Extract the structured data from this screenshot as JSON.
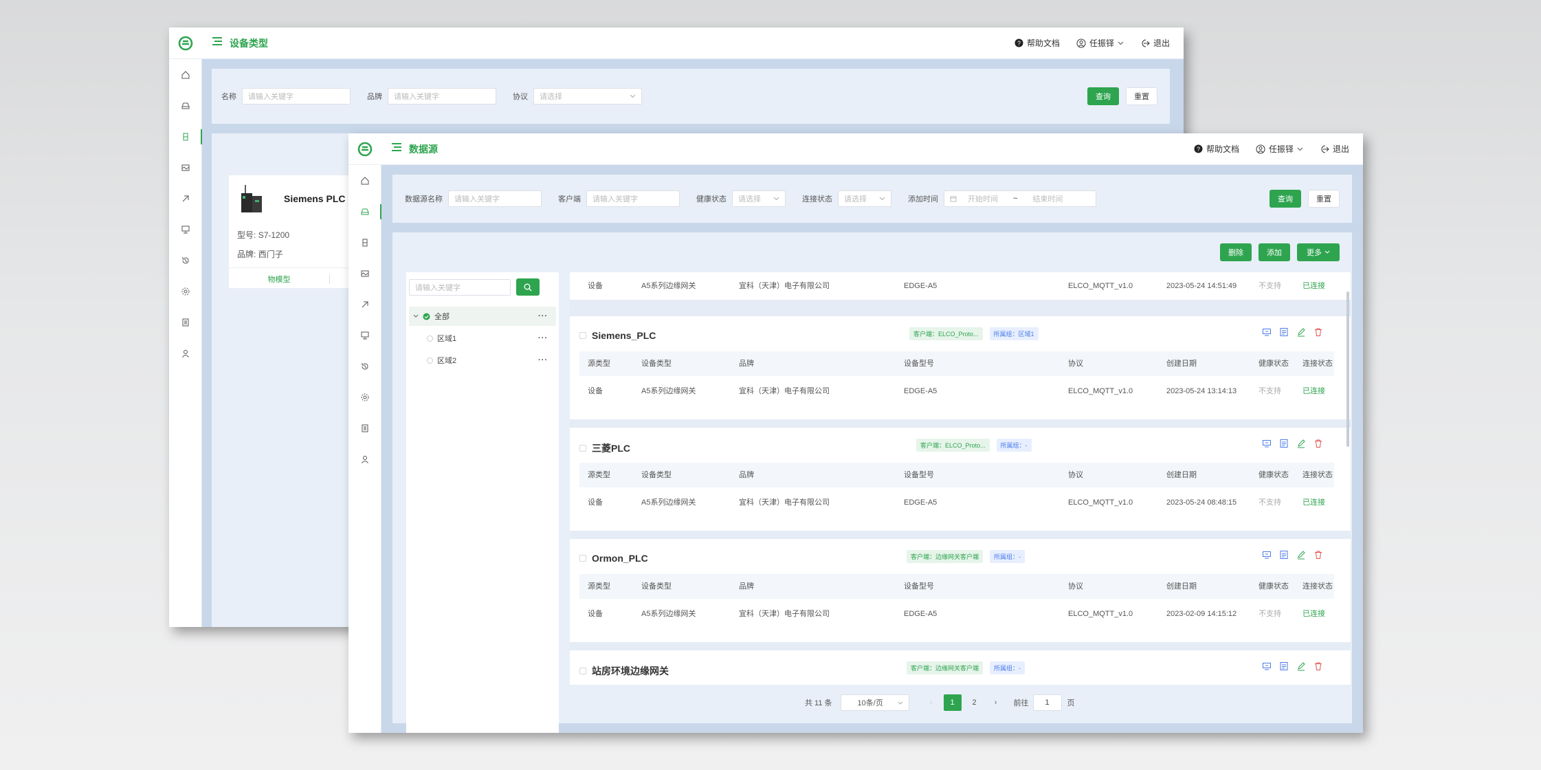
{
  "back_window": {
    "title": "设备类型",
    "topbar": {
      "help": "帮助文档",
      "user": "任振铎",
      "logout": "退出"
    },
    "filters": {
      "name_label": "名称",
      "name_placeholder": "请输入关键字",
      "brand_label": "品牌",
      "brand_placeholder": "请输入关键字",
      "protocol_label": "协议",
      "protocol_placeholder": "请选择",
      "query": "查询",
      "reset": "重置"
    },
    "device_card": {
      "name": "Siemens PLC",
      "model_label": "型号:",
      "model": "S7-1200",
      "brand_label": "品牌:",
      "brand": "西门子",
      "action": "物模型"
    }
  },
  "front_window": {
    "title": "数据源",
    "topbar": {
      "help": "帮助文档",
      "user": "任振铎",
      "logout": "退出"
    },
    "filters": {
      "ds_name_label": "数据源名称",
      "ds_name_placeholder": "请输入关键字",
      "client_label": "客户端",
      "client_placeholder": "请输入关键字",
      "health_label": "健康状态",
      "health_placeholder": "请选择",
      "conn_label": "连接状态",
      "conn_placeholder": "请选择",
      "time_label": "添加时间",
      "time_start": "开始时间",
      "time_sep": "~",
      "time_end": "结束时间",
      "query": "查询",
      "reset": "重置"
    },
    "actions": {
      "delete": "删除",
      "add": "添加",
      "more": "更多"
    },
    "tree": {
      "search_placeholder": "请输入关键字",
      "items": [
        {
          "label": "全部"
        },
        {
          "label": "区域1"
        },
        {
          "label": "区域2"
        }
      ]
    },
    "columns": [
      "源类型",
      "设备类型",
      "品牌",
      "设备型号",
      "协议",
      "创建日期",
      "健康状态",
      "连接状态"
    ],
    "partial_row": [
      "设备",
      "A5系列边缘网关",
      "宜科（天津）电子有限公司",
      "EDGE-A5",
      "ELCO_MQTT_v1.0",
      "2023-05-24 14:51:49",
      "不支持",
      "已连接"
    ],
    "sources": [
      {
        "name": "Siemens_PLC",
        "client_tag": "客户端：ELCO_Proto...",
        "group_tag": "所属组：区域1",
        "row": [
          "设备",
          "A5系列边缘网关",
          "宜科（天津）电子有限公司",
          "EDGE-A5",
          "ELCO_MQTT_v1.0",
          "2023-05-24 13:14:13",
          "不支持",
          "已连接"
        ]
      },
      {
        "name": "三菱PLC",
        "client_tag": "客户端：ELCO_Proto...",
        "group_tag": "所属组：-",
        "row": [
          "设备",
          "A5系列边缘网关",
          "宜科（天津）电子有限公司",
          "EDGE-A5",
          "ELCO_MQTT_v1.0",
          "2023-05-24 08:48:15",
          "不支持",
          "已连接"
        ]
      },
      {
        "name": "Ormon_PLC",
        "client_tag": "客户端：边缘网关客户端",
        "group_tag": "所属组：-",
        "row": [
          "设备",
          "A5系列边缘网关",
          "宜科（天津）电子有限公司",
          "EDGE-A5",
          "ELCO_MQTT_v1.0",
          "2023-02-09 14:15:12",
          "不支持",
          "已连接"
        ]
      },
      {
        "name": "站房环境边缘网关",
        "client_tag": "客户端：边缘网关客户端",
        "group_tag": "所属组：-"
      }
    ],
    "pager": {
      "total": "共 11 条",
      "page_size": "10条/页",
      "pages": [
        "1",
        "2"
      ],
      "goto_label": "前往",
      "goto_value": "1",
      "page_suffix": "页"
    }
  },
  "colors": {
    "accent": "#2ea44f",
    "blue": "#4a7ae8",
    "red": "#e0524c"
  }
}
